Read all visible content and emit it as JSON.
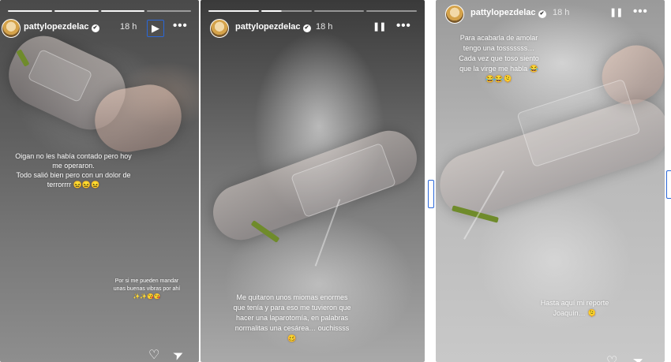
{
  "user": {
    "username": "pattylopezdelac",
    "time": "18 h",
    "verified_glyph": "✔"
  },
  "icons": {
    "play": "▶",
    "pause": "❚❚",
    "more": "•••",
    "heart": "♡",
    "send": "➤"
  },
  "stories": [
    {
      "caption_main": "Oigan no les había contado pero hoy me operaron.\nTodo salió bien pero con un dolor de terrorrrr 😖😖😖",
      "caption_small": "Por si me pueden mandar unas buenas vibras por ahí ✨✨😘😘"
    },
    {
      "caption_main": "Me quitaron unos miomas enormes que tenía y para eso me tuvieron que hacer una laparotomía, en palabras normalitas una cesárea… ouchissss 🥴"
    },
    {
      "caption_top": "Para acabarla de amolar tengo una tosssssss… Cada vez que toso siento que la virge me habla 😂😂😂🫠",
      "caption_bottom": "Hasta aquí mi reporte Joaquín… 🫠"
    }
  ]
}
